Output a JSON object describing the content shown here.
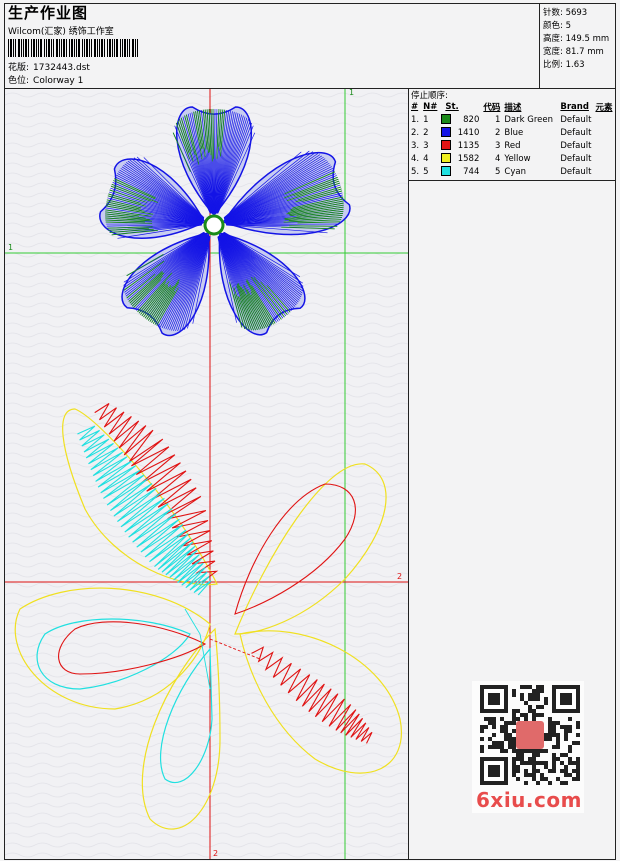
{
  "header": {
    "title": "生产作业图",
    "company": "Wilcom(汇家) 绣饰工作室",
    "design_label": "花版:",
    "design_value": "1732443.dst",
    "colorway_label": "色位:",
    "colorway_value": "Colorway 1"
  },
  "stats": [
    {
      "label": "针数:",
      "value": "5693"
    },
    {
      "label": "颜色:",
      "value": "5"
    },
    {
      "label": "高度:",
      "value": "149.5 mm"
    },
    {
      "label": "宽度:",
      "value": "81.7 mm"
    },
    {
      "label": "比例:",
      "value": "1.63"
    }
  ],
  "stop_sequence": {
    "title": "停止顺序:",
    "headers": [
      "#",
      "N#",
      "St.",
      "代码",
      "描述",
      "Brand",
      "元素"
    ],
    "rows": [
      {
        "idx": "1.",
        "n": "1",
        "stitches": "820",
        "code": "1",
        "desc": "Dark Green",
        "brand": "Default",
        "color": "#1a8a1a"
      },
      {
        "idx": "2.",
        "n": "2",
        "stitches": "1410",
        "code": "2",
        "desc": "Blue",
        "brand": "Default",
        "color": "#1414e6"
      },
      {
        "idx": "3.",
        "n": "3",
        "stitches": "1135",
        "code": "3",
        "desc": "Red",
        "brand": "Default",
        "color": "#e01414"
      },
      {
        "idx": "4.",
        "n": "4",
        "stitches": "1582",
        "code": "4",
        "desc": "Yellow",
        "brand": "Default",
        "color": "#f0f020"
      },
      {
        "idx": "5.",
        "n": "5",
        "stitches": "744",
        "code": "5",
        "desc": "Cyan",
        "brand": "Default",
        "color": "#20e0e0"
      }
    ]
  },
  "axes": {
    "green_label": "1",
    "red_label": "2"
  },
  "watermark": {
    "text": "6xiu.com"
  }
}
